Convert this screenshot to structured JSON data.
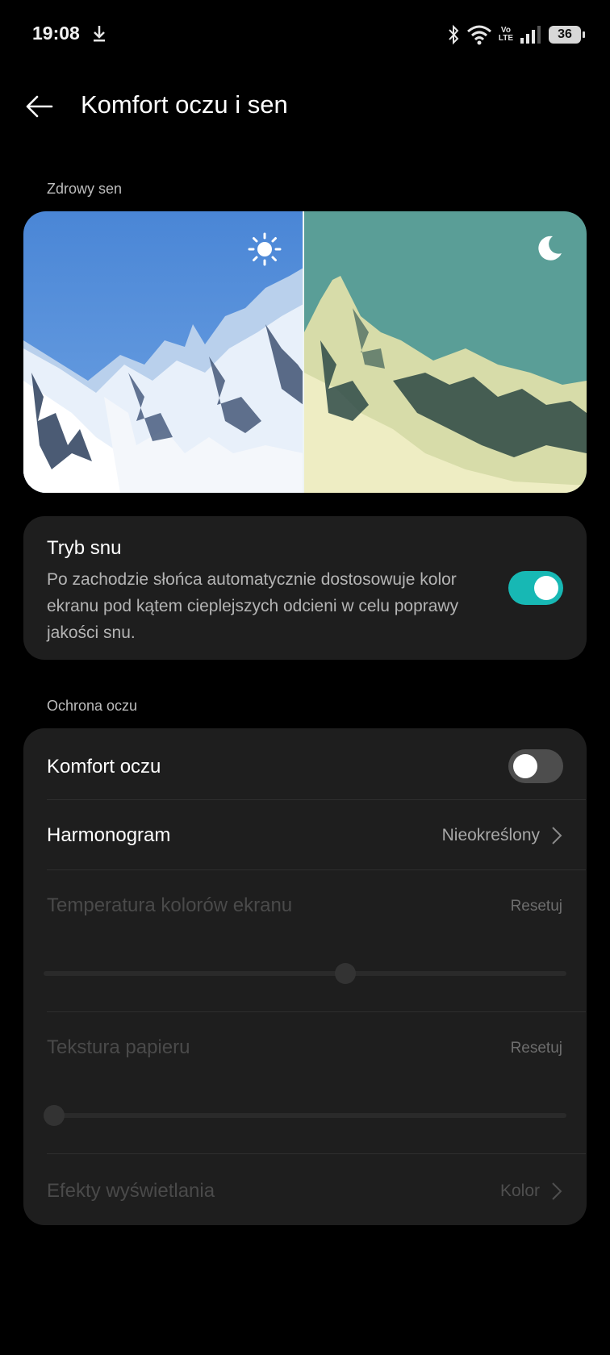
{
  "status_bar": {
    "time": "19:08",
    "volte_top": "Vo",
    "volte_bottom": "LTE",
    "battery": "36",
    "icons": [
      "download-icon",
      "bluetooth-icon",
      "wifi-icon",
      "signal-icon",
      "battery-icon"
    ]
  },
  "header": {
    "title": "Komfort oczu i sen"
  },
  "healthy_sleep": {
    "section_label": "Zdrowy sen",
    "preview_icons": [
      "sun-icon",
      "moon-icon"
    ]
  },
  "sleep_mode": {
    "title": "Tryb snu",
    "description": "Po zachodzie słońca automatycznie dostosowuje kolor ekranu pod kątem cieplejszych odcieni w celu poprawy jakości snu.",
    "enabled": true
  },
  "eye_protection": {
    "section_label": "Ochrona oczu",
    "eye_comfort": {
      "label": "Komfort oczu",
      "enabled": false
    },
    "schedule": {
      "label": "Harmonogram",
      "value": "Nieokreślony"
    },
    "color_temperature": {
      "label": "Temperatura kolorów ekranu",
      "reset_label": "Resetuj",
      "level": 0.58
    },
    "paper_texture": {
      "label": "Tekstura papieru",
      "reset_label": "Resetuj",
      "level": 0.0
    },
    "display_effects": {
      "label": "Efekty wyświetlania",
      "value": "Kolor"
    }
  },
  "colors": {
    "accent": "#17b8b4",
    "background": "#000000",
    "card": "#1e1e1e"
  }
}
